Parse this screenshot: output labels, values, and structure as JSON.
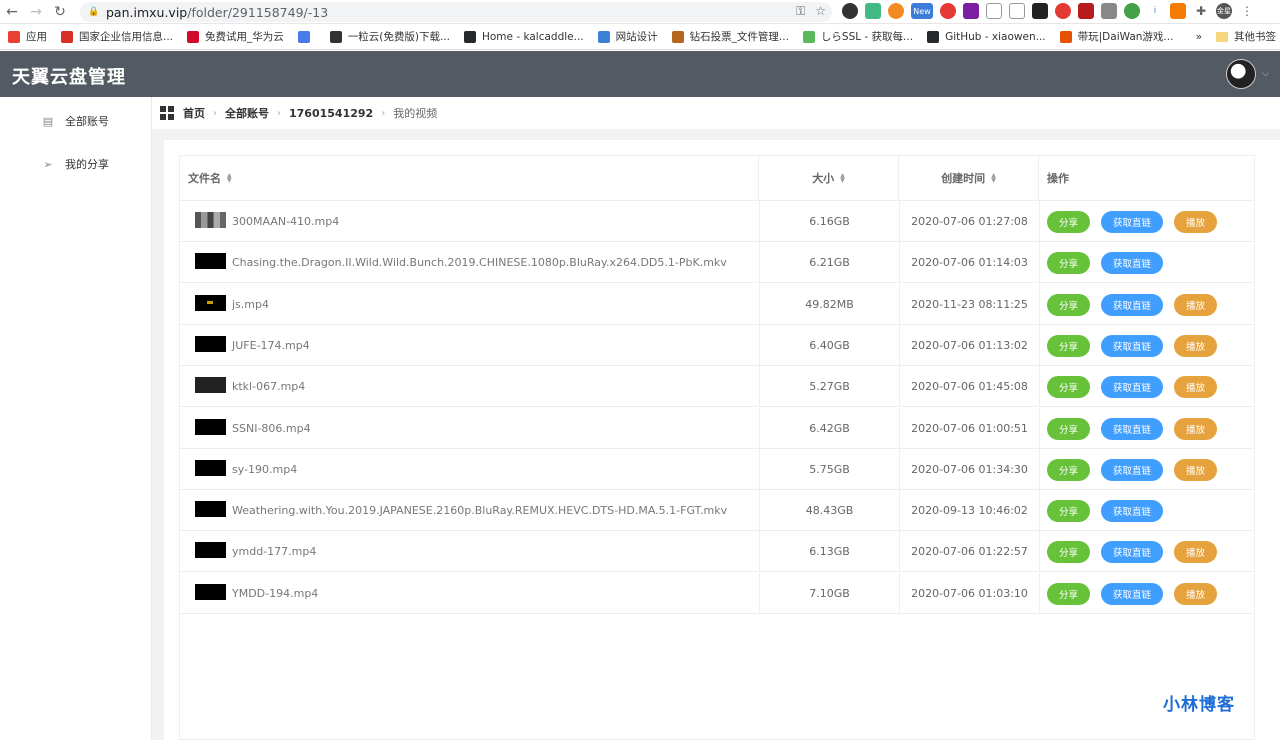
{
  "browser": {
    "url_host": "pan.imxu.vip",
    "url_path": "/folder/291158749/-13",
    "bookmarks": [
      {
        "label": "应用",
        "color": "#e94235"
      },
      {
        "label": "国家企业信用信息...",
        "color": "#d93025"
      },
      {
        "label": "免费试用_华为云",
        "color": "#cf0a2c"
      },
      {
        "label": "",
        "color": "#4a7be8"
      },
      {
        "label": "一粒云(免费版)下载...",
        "color": "#333333"
      },
      {
        "label": "Home - kalcaddle...",
        "color": "#24292e"
      },
      {
        "label": "网站设计",
        "color": "#3b82d6"
      },
      {
        "label": "钻石投票_文件管理...",
        "color": "#b5651d"
      },
      {
        "label": "しらSSL - 获取每...",
        "color": "#5cb85c"
      },
      {
        "label": "GitHub - xiaowen...",
        "color": "#24292e"
      },
      {
        "label": "带玩|DaiWan游戏...",
        "color": "#e65100"
      }
    ],
    "other_bookmarks": "其他书签",
    "more": "»",
    "ext_new_badge": "New",
    "ext_profile": "金星"
  },
  "app": {
    "title": "天翼云盘管理"
  },
  "sidebar": {
    "items": [
      {
        "label": "全部账号",
        "icon": "document-icon"
      },
      {
        "label": "我的分享",
        "icon": "send-icon"
      }
    ]
  },
  "breadcrumb": [
    "首页",
    "全部账号",
    "17601541292",
    "我的视频"
  ],
  "table": {
    "headers": {
      "name": "文件名",
      "size": "大小",
      "created": "创建时间",
      "actions": "操作"
    },
    "actions": {
      "share": "分享",
      "link": "获取直链",
      "play": "播放"
    },
    "rows": [
      {
        "name": "300MAAN-410.mp4",
        "size": "6.16GB",
        "created": "2020-07-06 01:27:08",
        "play": true,
        "thumb": "img"
      },
      {
        "name": "Chasing.the.Dragon.II.Wild.Wild.Bunch.2019.CHINESE.1080p.BluRay.x264.DD5.1-PbK.mkv",
        "size": "6.21GB",
        "created": "2020-07-06 01:14:03",
        "play": false,
        "thumb": "black"
      },
      {
        "name": "js.mp4",
        "size": "49.82MB",
        "created": "2020-11-23 08:11:25",
        "play": true,
        "thumb": "dots"
      },
      {
        "name": "JUFE-174.mp4",
        "size": "6.40GB",
        "created": "2020-07-06 01:13:02",
        "play": true,
        "thumb": "black"
      },
      {
        "name": "ktkl-067.mp4",
        "size": "5.27GB",
        "created": "2020-07-06 01:45:08",
        "play": true,
        "thumb": "dark"
      },
      {
        "name": "SSNI-806.mp4",
        "size": "6.42GB",
        "created": "2020-07-06 01:00:51",
        "play": true,
        "thumb": "black"
      },
      {
        "name": "sy-190.mp4",
        "size": "5.75GB",
        "created": "2020-07-06 01:34:30",
        "play": true,
        "thumb": "black"
      },
      {
        "name": "Weathering.with.You.2019.JAPANESE.2160p.BluRay.REMUX.HEVC.DTS-HD.MA.5.1-FGT.mkv",
        "size": "48.43GB",
        "created": "2020-09-13 10:46:02",
        "play": false,
        "thumb": "black"
      },
      {
        "name": "ymdd-177.mp4",
        "size": "6.13GB",
        "created": "2020-07-06 01:22:57",
        "play": true,
        "thumb": "black"
      },
      {
        "name": "YMDD-194.mp4",
        "size": "7.10GB",
        "created": "2020-07-06 01:03:10",
        "play": true,
        "thumb": "black"
      }
    ]
  },
  "watermark": "小林博客",
  "colors": {
    "header_bg": "#535a63",
    "share": "#67c23a",
    "link": "#409eff",
    "play": "#e6a23c"
  }
}
